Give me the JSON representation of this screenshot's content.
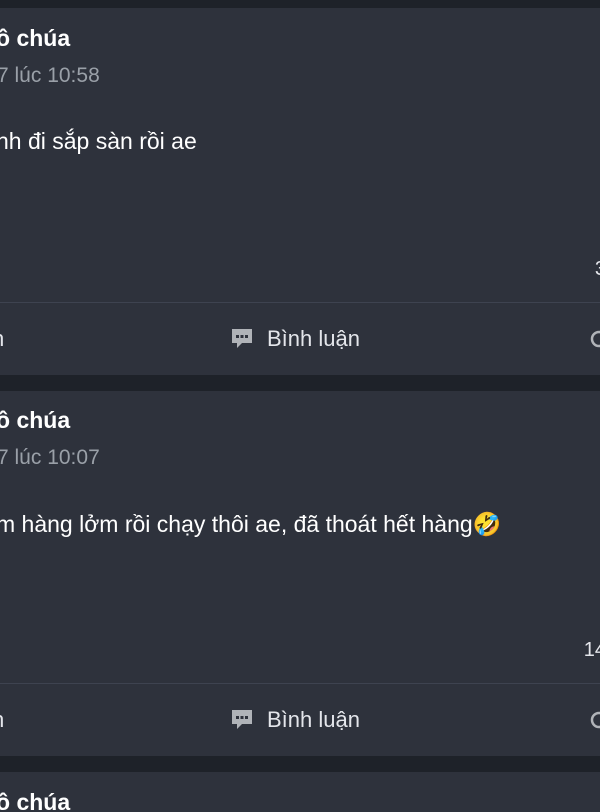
{
  "posts": [
    {
      "author": "ồ chúa",
      "timestamp": "7 lúc 10:58",
      "text": "nh đi sắp sàn rồi ae",
      "count": "3",
      "action_left": "n",
      "comment_label": "Bình luận"
    },
    {
      "author": "ồ chúa",
      "timestamp": "7 lúc 10:07",
      "text": "m hàng lởm rồi chạy thôi ae, đã thoát hết hàng🤣",
      "count": "14",
      "action_left": "n",
      "comment_label": "Bình luận"
    },
    {
      "author": "ồ chúa"
    }
  ],
  "icons": {
    "comment": "comment-icon",
    "share": "share-icon"
  },
  "colors": {
    "page_background": "#1e2229",
    "card_background": "#2e323c",
    "secondary_text": "#9aa0a8"
  }
}
